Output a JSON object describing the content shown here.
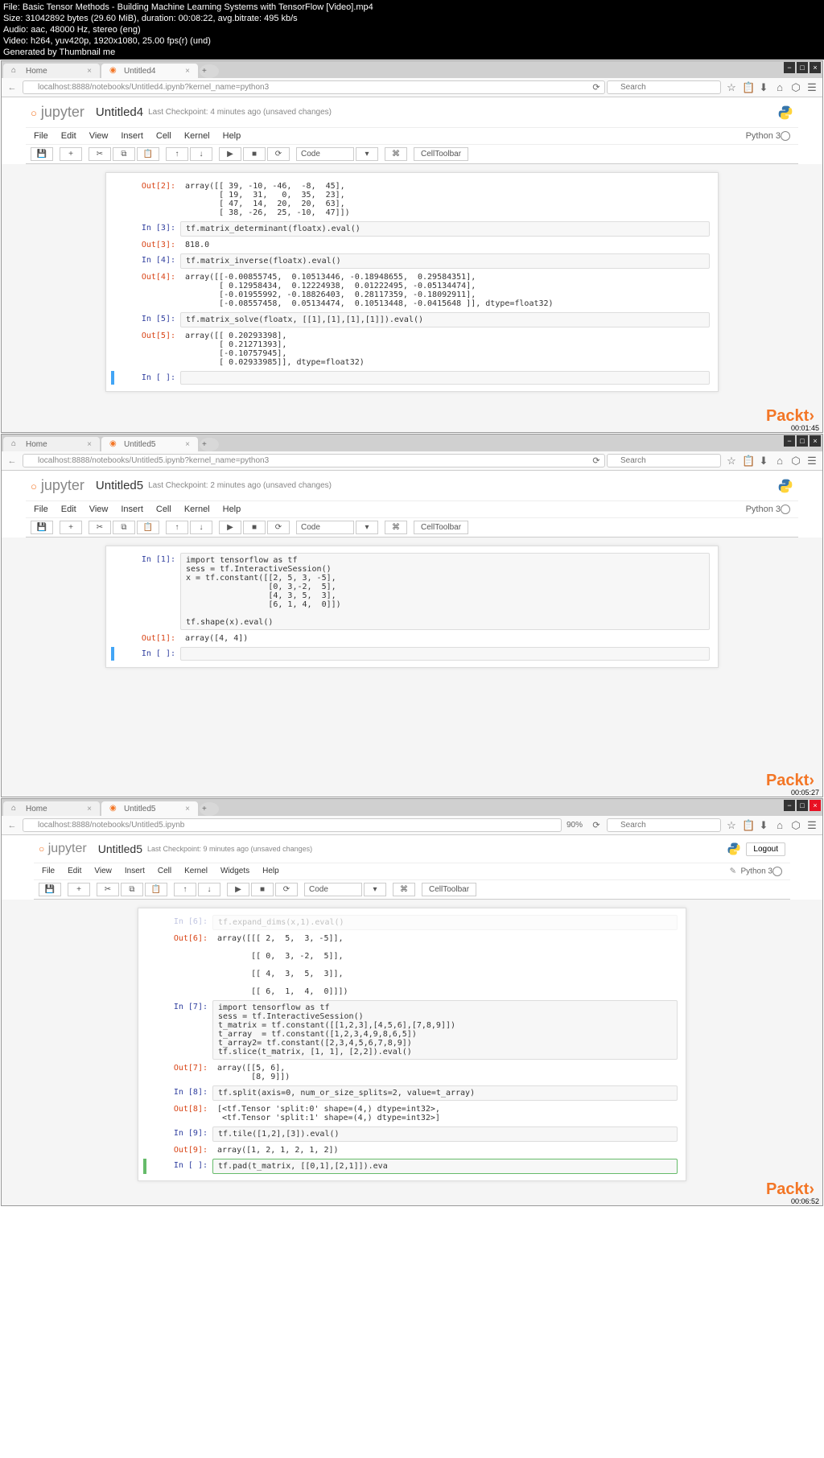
{
  "fileinfo": {
    "l1": "File: Basic Tensor Methods - Building Machine Learning Systems with TensorFlow [Video].mp4",
    "l2": "Size: 31042892 bytes (29.60 MiB), duration: 00:08:22, avg.bitrate: 495 kb/s",
    "l3": "Audio: aac, 48000 Hz, stereo (eng)",
    "l4": "Video: h264, yuv420p, 1920x1080, 25.00 fps(r) (und)",
    "l5": "Generated by Thumbnail me"
  },
  "frame1": {
    "tab_home": "Home",
    "tab_nb": "Untitled4",
    "url": "localhost:8888/notebooks/Untitled4.ipynb?kernel_name=python3",
    "search_ph": "Search",
    "nb_title": "Untitled4",
    "checkpoint": "Last Checkpoint: 4 minutes ago (unsaved changes)",
    "menus": {
      "file": "File",
      "edit": "Edit",
      "view": "View",
      "insert": "Insert",
      "cell": "Cell",
      "kernel": "Kernel",
      "help": "Help",
      "kernel_name": "Python 3"
    },
    "celltype": "Code",
    "celltoolbar": "CellToolbar",
    "cells": {
      "out2_p": "Out[2]:",
      "out2": "array([[ 39, -10, -46,  -8,  45],\n       [ 19,  31,   0,  35,  23],\n       [ 47,  14,  20,  20,  63],\n       [ 38, -26,  25, -10,  47]])",
      "in3_p": "In [3]:",
      "in3": "tf.matrix_determinant(floatx).eval()",
      "out3_p": "Out[3]:",
      "out3": "818.0",
      "in4_p": "In [4]:",
      "in4": "tf.matrix_inverse(floatx).eval()",
      "out4_p": "Out[4]:",
      "out4": "array([[-0.00855745,  0.10513446, -0.18948655,  0.29584351],\n       [ 0.12958434,  0.12224938,  0.01222495, -0.05134474],\n       [-0.01955992, -0.18826403,  0.28117359, -0.18092911],\n       [-0.08557458,  0.05134474,  0.10513448, -0.0415648 ]], dtype=float32)",
      "in5_p": "In [5]:",
      "in5": "tf.matrix_solve(floatx, [[1],[1],[1],[1]]).eval()",
      "out5_p": "Out[5]:",
      "out5": "array([[ 0.20293398],\n       [ 0.21271393],\n       [-0.10757945],\n       [ 0.02933985]], dtype=float32)",
      "in_empty_p": "In [ ]:"
    },
    "watermark": "Packt›",
    "time": "00:01:45"
  },
  "frame2": {
    "tab_home": "Home",
    "tab_nb": "Untitled5",
    "url": "localhost:8888/notebooks/Untitled5.ipynb?kernel_name=python3",
    "search_ph": "Search",
    "nb_title": "Untitled5",
    "checkpoint": "Last Checkpoint: 2 minutes ago (unsaved changes)",
    "menus": {
      "file": "File",
      "edit": "Edit",
      "view": "View",
      "insert": "Insert",
      "cell": "Cell",
      "kernel": "Kernel",
      "help": "Help",
      "kernel_name": "Python 3"
    },
    "celltype": "Code",
    "celltoolbar": "CellToolbar",
    "cells": {
      "in1_p": "In [1]:",
      "in1": "import tensorflow as tf\nsess = tf.InteractiveSession()\nx = tf.constant([[2, 5, 3, -5],\n                 [0, 3,-2,  5],\n                 [4, 3, 5,  3],\n                 [6, 1, 4,  0]])\n\ntf.shape(x).eval()",
      "out1_p": "Out[1]:",
      "out1": "array([4, 4])",
      "in_empty_p": "In [ ]:"
    },
    "watermark": "Packt›",
    "time": "00:05:27"
  },
  "frame3": {
    "tab_home": "Home",
    "tab_nb": "Untitled5",
    "url": "localhost:8888/notebooks/Untitled5.ipynb",
    "zoom": "90%",
    "search_ph": "Search",
    "nb_title": "Untitled5",
    "checkpoint": "Last Checkpoint: 9 minutes ago (unsaved changes)",
    "logout": "Logout",
    "menus": {
      "file": "File",
      "edit": "Edit",
      "view": "View",
      "insert": "Insert",
      "cell": "Cell",
      "kernel": "Kernel",
      "widgets": "Widgets",
      "help": "Help",
      "kernel_name": "Python 3"
    },
    "celltype": "Code",
    "celltoolbar": "CellToolbar",
    "cells": {
      "in6_p": "In [6]:",
      "in6": "tf.expand_dims(x,1).eval()",
      "out6_p": "Out[6]:",
      "out6": "array([[[ 2,  5,  3, -5]],\n\n       [[ 0,  3, -2,  5]],\n\n       [[ 4,  3,  5,  3]],\n\n       [[ 6,  1,  4,  0]]])",
      "in7_p": "In [7]:",
      "in7": "import tensorflow as tf\nsess = tf.InteractiveSession()\nt_matrix = tf.constant([[1,2,3],[4,5,6],[7,8,9]])\nt_array  = tf.constant([1,2,3,4,9,8,6,5])\nt_array2= tf.constant([2,3,4,5,6,7,8,9])\ntf.slice(t_matrix, [1, 1], [2,2]).eval()",
      "out7_p": "Out[7]:",
      "out7": "array([[5, 6],\n       [8, 9]])",
      "in8_p": "In [8]:",
      "in8": "tf.split(axis=0, num_or_size_splits=2, value=t_array)",
      "out8_p": "Out[8]:",
      "out8": "[<tf.Tensor 'split:0' shape=(4,) dtype=int32>,\n <tf.Tensor 'split:1' shape=(4,) dtype=int32>]",
      "in9_p": "In [9]:",
      "in9": "tf.tile([1,2],[3]).eval()",
      "out9_p": "Out[9]:",
      "out9": "array([1, 2, 1, 2, 1, 2])",
      "in_empty_p": "In [ ]:",
      "in_empty": "tf.pad(t_matrix, [[0,1],[2,1]]).eva"
    },
    "watermark": "Packt›",
    "time": "00:06:52"
  }
}
